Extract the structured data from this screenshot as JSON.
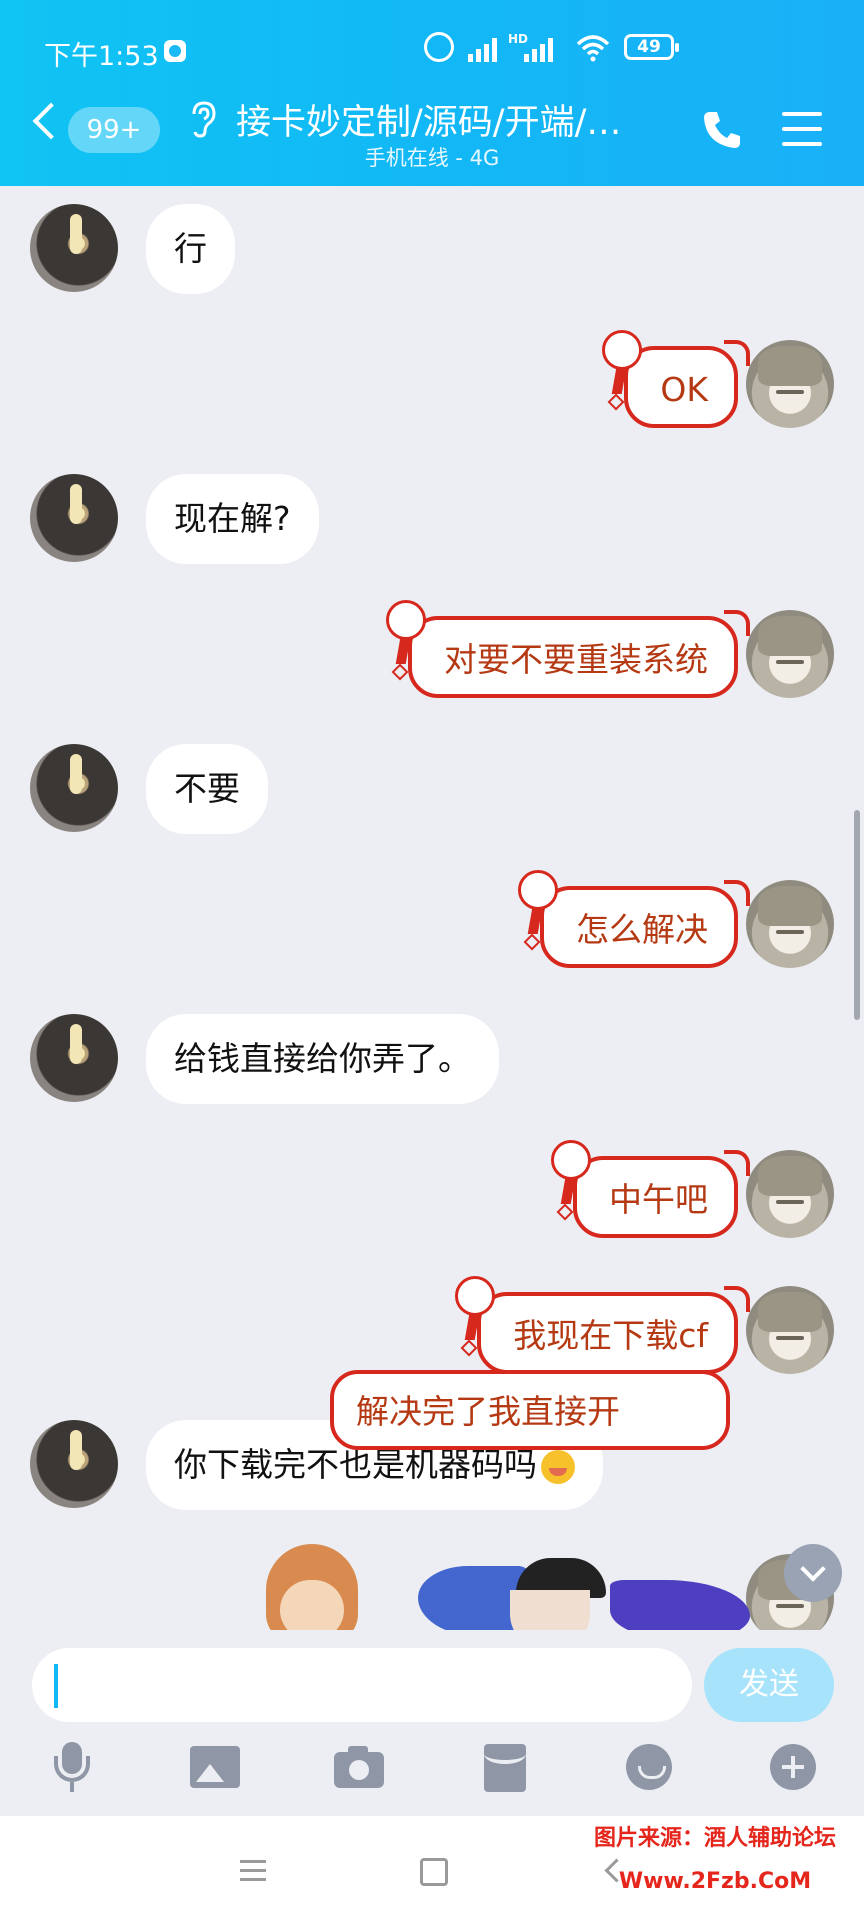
{
  "status_bar": {
    "time": "下午1:53",
    "network": "HD",
    "battery": "49"
  },
  "header": {
    "unread_count": "99+",
    "title": "接卡妙定制/源码/开端/…",
    "subtitle": "手机在线 - 4G"
  },
  "messages": [
    {
      "side": "left",
      "text": "行"
    },
    {
      "side": "right",
      "text": "OK"
    },
    {
      "side": "left",
      "text": "现在解?"
    },
    {
      "side": "right",
      "text": "对要不要重装系统"
    },
    {
      "side": "left",
      "text": "不要"
    },
    {
      "side": "right",
      "text": "怎么解决"
    },
    {
      "side": "left",
      "text": "给钱直接给你弄了。"
    },
    {
      "side": "right",
      "text": "中午吧"
    },
    {
      "side": "right",
      "text": "我现在下载cf"
    },
    {
      "side": "left",
      "text": "你下载完不也是机器码吗"
    },
    {
      "side": "right",
      "text": "解决完了我直接开"
    }
  ],
  "input": {
    "placeholder": "",
    "send_label": "发送"
  },
  "toolbar": [
    "mic-icon",
    "image-icon",
    "camera-icon",
    "redpacket-icon",
    "emoji-icon",
    "plus-icon"
  ],
  "watermark": {
    "line1": "图片来源：酒人辅助论坛",
    "line2": "Www.2Fzb.CoM"
  },
  "colors": {
    "header": "#12b8f5",
    "bubble_border": "#d7281d",
    "bubble_text": "#b53a14",
    "send": "#a7e4fb"
  }
}
